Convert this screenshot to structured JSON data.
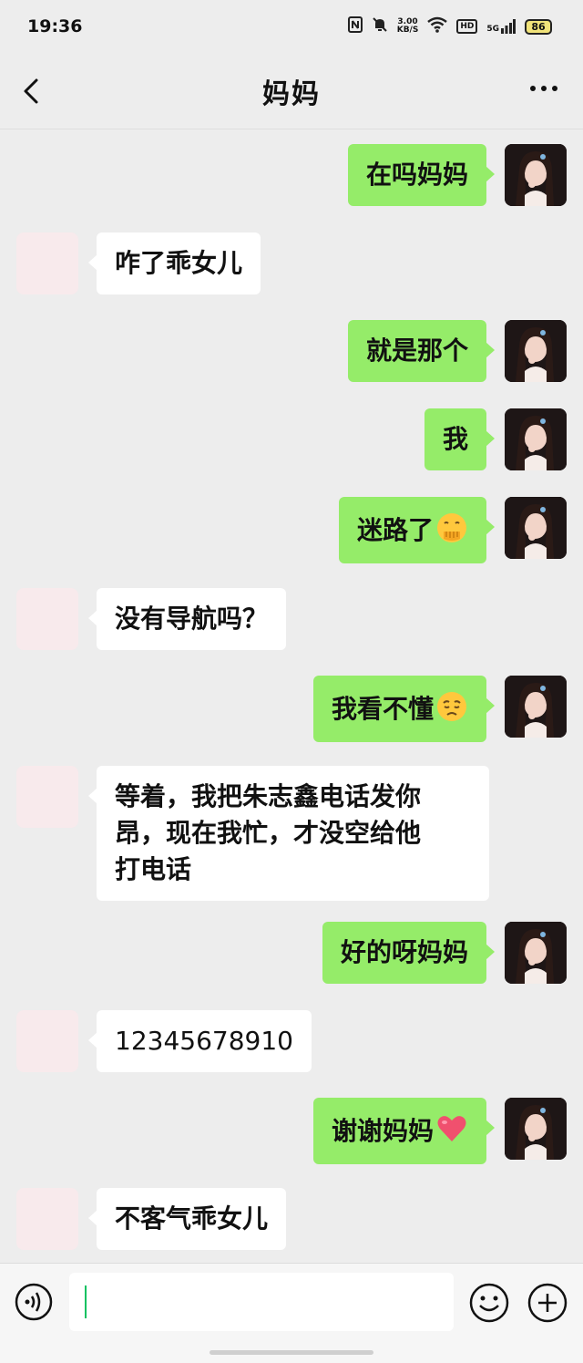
{
  "status": {
    "time": "19:36",
    "speed_value": "3.00",
    "speed_unit": "KB/S",
    "hd_label": "HD",
    "network": "5G",
    "battery": "86"
  },
  "header": {
    "title": "妈妈"
  },
  "messages": [
    {
      "sender": "me",
      "text": "在吗妈妈"
    },
    {
      "sender": "mom",
      "text": "咋了乖女儿"
    },
    {
      "sender": "me",
      "text": "就是那个"
    },
    {
      "sender": "me",
      "text": "我"
    },
    {
      "sender": "me",
      "text": "迷路了",
      "emoji": "hand-over-mouth-emoji"
    },
    {
      "sender": "mom",
      "text": "没有导航吗？"
    },
    {
      "sender": "me",
      "text": "我看不懂",
      "emoji": "pensive-face-emoji"
    },
    {
      "sender": "mom",
      "text_lines": [
        "等着，我把朱志鑫电话发你",
        "昂，现在我忙，才没空给他",
        "打电话"
      ]
    },
    {
      "sender": "me",
      "text": "好的呀妈妈"
    },
    {
      "sender": "mom",
      "text": "12345678910"
    },
    {
      "sender": "me",
      "text": "谢谢妈妈",
      "emoji": "red-heart-emoji"
    },
    {
      "sender": "mom",
      "text": "不客气乖女儿"
    }
  ],
  "input": {
    "value": "",
    "placeholder": ""
  },
  "colors": {
    "background": "#ededed",
    "my_bubble": "#95ec69",
    "mom_bubble": "#ffffff",
    "cursor": "#07c160"
  }
}
